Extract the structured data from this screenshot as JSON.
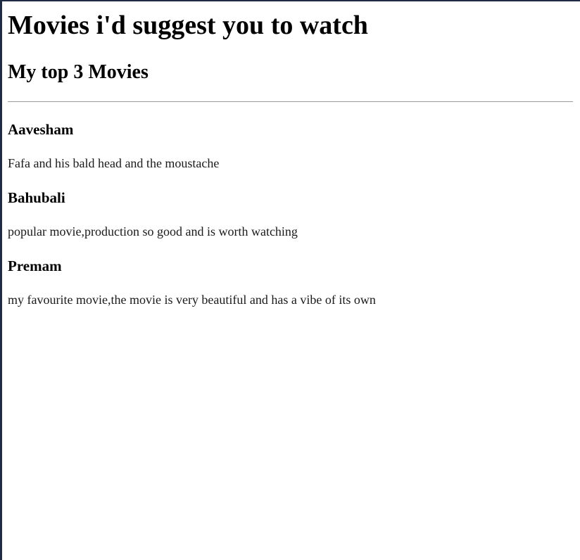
{
  "page": {
    "heading": "Movies i'd suggest you to watch",
    "subheading": "My top 3 Movies"
  },
  "movies": [
    {
      "title": "Aavesham",
      "description": "Fafa and his bald head and the moustache"
    },
    {
      "title": "Bahubali",
      "description": "popular movie,production so good and is worth watching"
    },
    {
      "title": "Premam",
      "description": "my favourite movie,the movie is very beautiful and has a vibe of its own"
    }
  ]
}
